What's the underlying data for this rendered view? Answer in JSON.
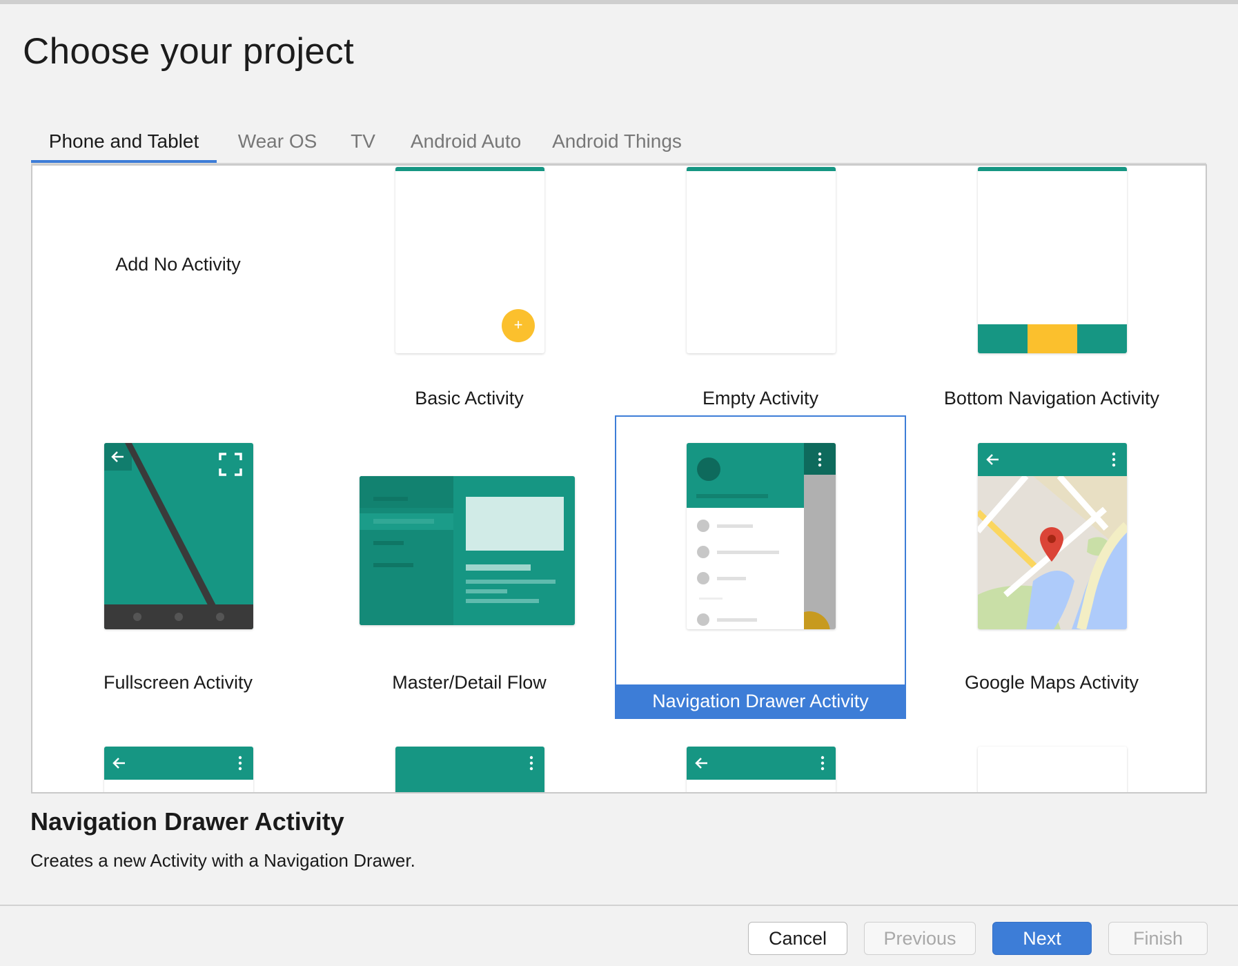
{
  "dialog": {
    "title": "Choose your project"
  },
  "tabs": [
    {
      "label": "Phone and Tablet",
      "active": true
    },
    {
      "label": "Wear OS",
      "active": false
    },
    {
      "label": "TV",
      "active": false
    },
    {
      "label": "Android Auto",
      "active": false
    },
    {
      "label": "Android Things",
      "active": false
    }
  ],
  "templates": [
    {
      "label": "Add No Activity"
    },
    {
      "label": "Basic Activity"
    },
    {
      "label": "Empty Activity"
    },
    {
      "label": "Bottom Navigation Activity"
    },
    {
      "label": "Fullscreen Activity"
    },
    {
      "label": "Master/Detail Flow"
    },
    {
      "label": "Navigation Drawer Activity",
      "selected": true
    },
    {
      "label": "Google Maps Activity"
    }
  ],
  "fab_symbol": "+",
  "description": {
    "title": "Navigation Drawer Activity",
    "text": "Creates a new Activity with a Navigation Drawer."
  },
  "buttons": {
    "cancel": "Cancel",
    "previous": "Previous",
    "next": "Next",
    "finish": "Finish"
  },
  "colors": {
    "accent": "#3d7dd7",
    "teal": "#169683",
    "teal_dark": "#0e6a5c",
    "fab": "#fbc02d"
  }
}
